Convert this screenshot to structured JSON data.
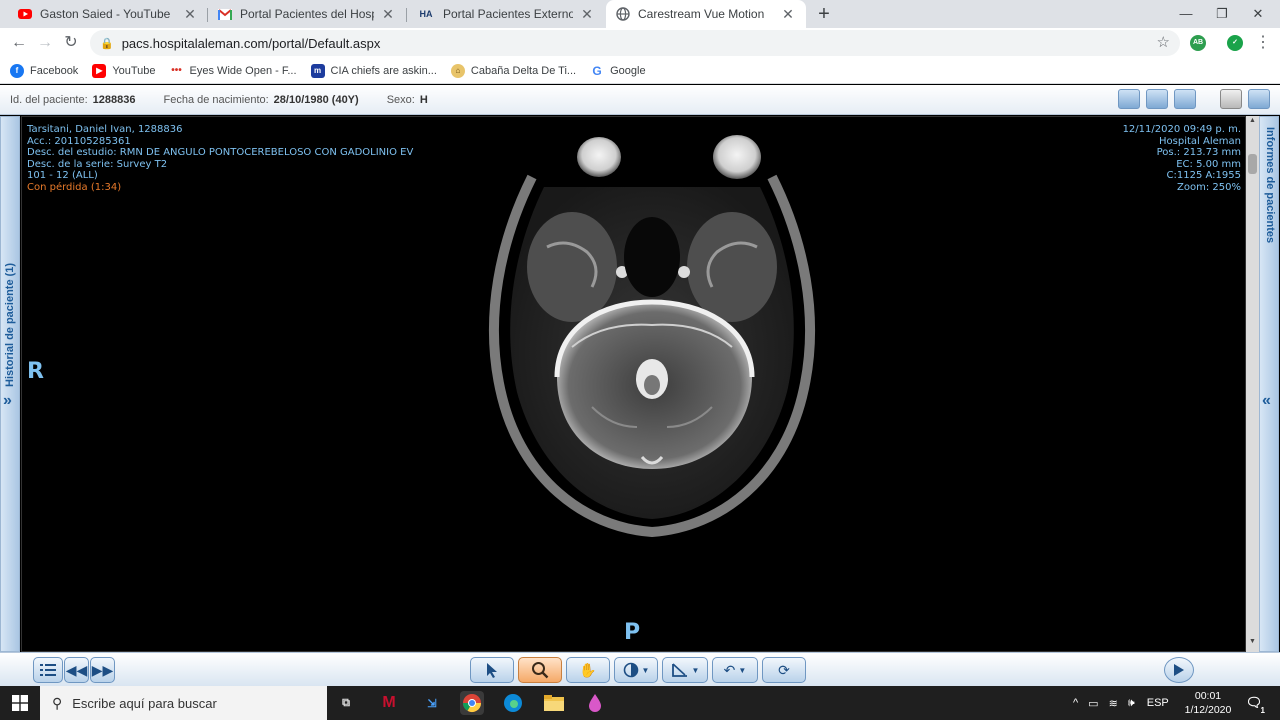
{
  "browser": {
    "tabs": [
      {
        "title": "Gaston Saied - YouTube",
        "icon": "youtube-icon",
        "color": "#ff0000"
      },
      {
        "title": "Portal Pacientes del Hospital Aleman",
        "icon": "gmail-icon",
        "color": "#d93025"
      },
      {
        "title": "Portal Pacientes Externos",
        "icon": "hospital-aleman-icon",
        "color": "#1d3c6e"
      },
      {
        "title": "Carestream Vue Motion",
        "icon": "globe-icon",
        "color": "#5f6368"
      }
    ],
    "url": "pacs.hospitalaleman.com/portal/Default.aspx",
    "extensions": [
      {
        "label": "AB",
        "color": "#2e9e4f"
      },
      {
        "label": "✓",
        "color": "#1aa34a"
      }
    ],
    "bookmarks": [
      {
        "label": "Facebook",
        "icon": "facebook-icon",
        "color": "#1877f2"
      },
      {
        "label": "YouTube",
        "icon": "youtube-icon",
        "color": "#ff0000"
      },
      {
        "label": "Eyes Wide Open - F...",
        "icon": "dots-icon",
        "color": "#d93025"
      },
      {
        "label": "CIA chiefs are askin...",
        "icon": "m-icon",
        "color": "#1d3c9e"
      },
      {
        "label": "Cabaña Delta De Ti...",
        "icon": "cabin-icon",
        "color": "#c79a2b"
      },
      {
        "label": "Google",
        "icon": "google-icon",
        "color": "#4285f4"
      }
    ]
  },
  "patient": {
    "id_label": "Id. del paciente:",
    "id_value": "1288836",
    "dob_label": "Fecha de nacimiento:",
    "dob_value": "28/10/1980 (40Y)",
    "sex_label": "Sexo:",
    "sex_value": "H"
  },
  "side_panels": {
    "left": "Historial de paciente (1)",
    "right": "Informes de pacientes",
    "left_chevron": "»",
    "right_chevron": "«"
  },
  "overlay": {
    "top_left": [
      "Tarsitani, Daniel Ivan, 1288836",
      "Acc.: 201105285361",
      "Desc. del estudio: RMN DE ANGULO PONTOCEREBELOSO CON GADOLINIO EV",
      "Desc. de la serie: Survey T2",
      "101 - 12 (ALL)"
    ],
    "compression": "Con pérdida (1:34)",
    "top_right": [
      "12/11/2020 09:49 p. m.",
      "Hospital Aleman",
      "Pos.: 213.73 mm",
      "EC: 5.00 mm",
      "C:1125 A:1955",
      "Zoom: 250%"
    ],
    "orientation_left": "R",
    "orientation_bottom": "P"
  },
  "taskbar": {
    "search_placeholder": "Escribe aquí para buscar",
    "language": "ESP",
    "time": "00:01",
    "date": "1/12/2020",
    "notification_count": "1"
  }
}
